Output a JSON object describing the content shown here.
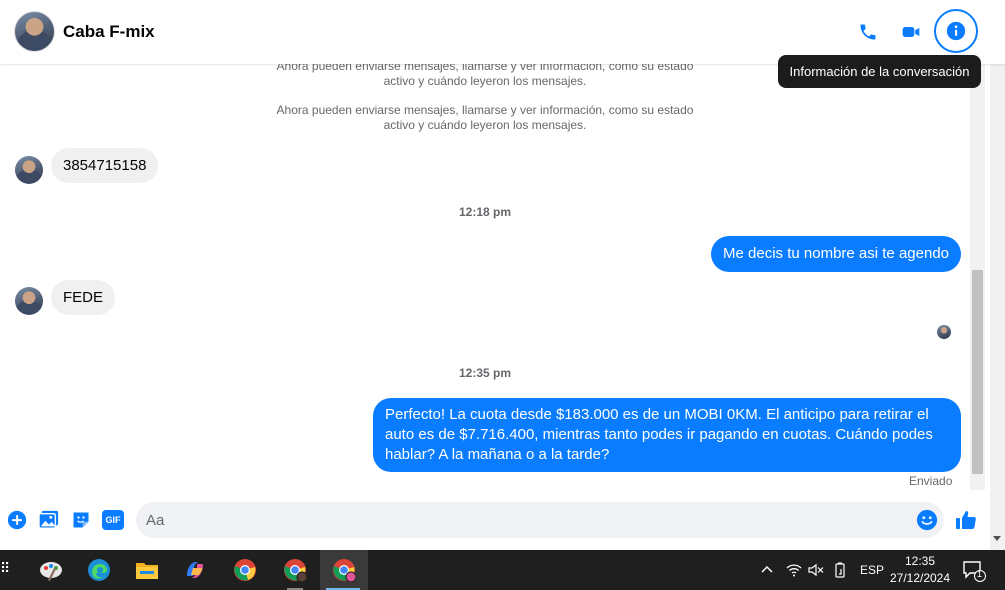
{
  "header": {
    "contact_name": "Caba F-mix",
    "tooltip": "Información de la conversación",
    "icons": [
      "phone-icon",
      "video-icon",
      "info-icon"
    ]
  },
  "messages": {
    "system_note_1": "Ahora pueden enviarse mensajes, llamarse y ver información, como su estado activo y cuándo leyeron los mensajes.",
    "system_note_2": "Ahora pueden enviarse mensajes, llamarse y ver información, como su estado activo y cuándo leyeron los mensajes.",
    "incoming_1": "3854715158",
    "time_1": "12:18 pm",
    "outgoing_1": "Me decis tu nombre asi te agendo",
    "incoming_2": "FEDE",
    "time_2": "12:35 pm",
    "outgoing_2": "Perfecto! La cuota desde $183.000 es de un MOBI 0KM. El anticipo para retirar el auto es de $7.716.400, mientras tanto podes ir pagando en cuotas. Cuándo podes hablar? A la mañana o a la tarde?",
    "status": "Enviado"
  },
  "composer": {
    "placeholder": "Aa",
    "value": "",
    "gif_label": "GIF"
  },
  "taskbar": {
    "language": "ESP",
    "time": "12:35",
    "date": "27/12/2024",
    "notification_count": "1"
  },
  "colors": {
    "accent": "#0a7cff",
    "bubble_in": "#f0f0f0",
    "taskbar": "#1f1f1f"
  }
}
